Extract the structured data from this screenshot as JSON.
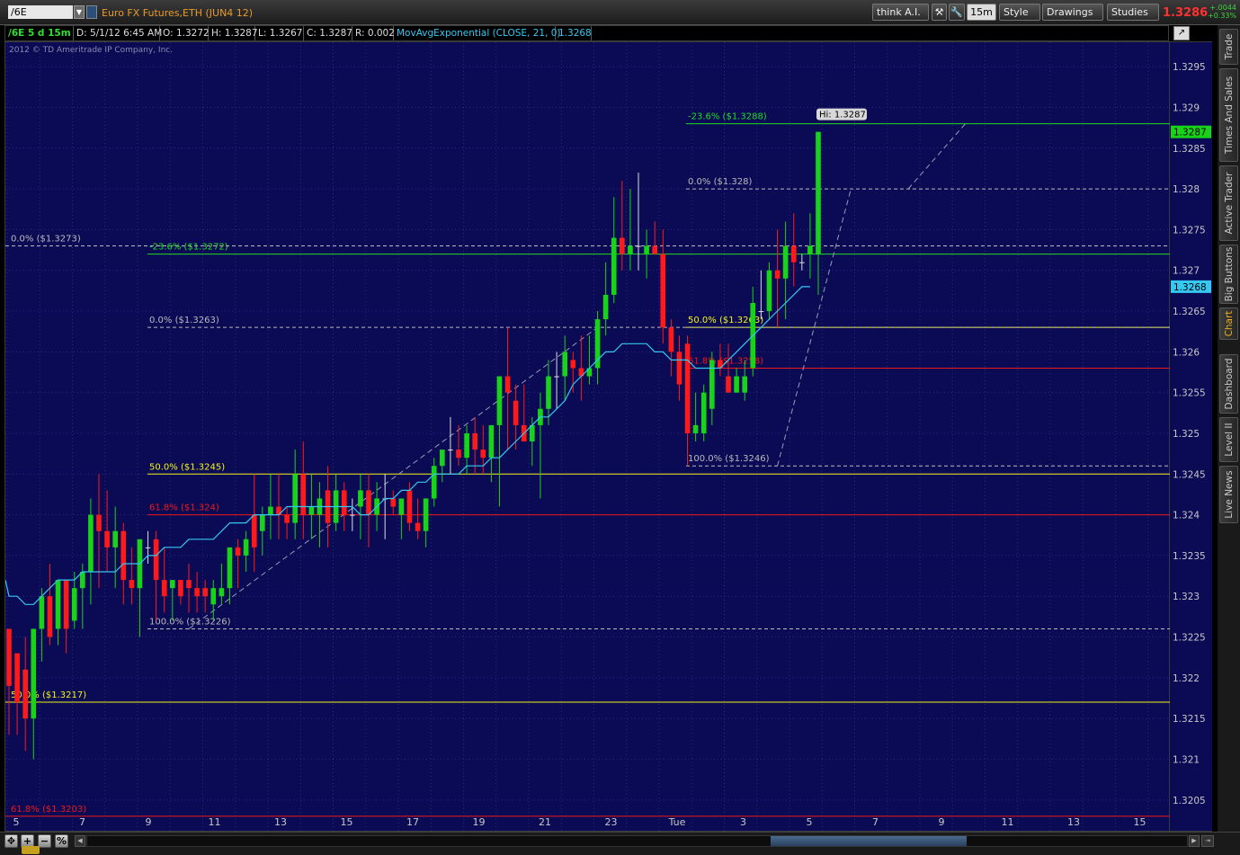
{
  "toolbar": {
    "symbol": "/6E",
    "description": "Euro FX Futures,ETH (JUN4 12)",
    "think_ai": "think A.I.",
    "period": "15m",
    "style": "Style",
    "drawings": "Drawings",
    "studies": "Studies",
    "last_price": "1.3286",
    "change_abs": "+.0044",
    "change_pct": "+0.33%"
  },
  "header": {
    "symbol_period": "/6E 5 d 15m",
    "date": "D: 5/1/12 6:45 AM",
    "open": "O: 1.3272",
    "high": "H: 1.3287",
    "low": "L: 1.3267",
    "close": "C: 1.3287",
    "range": "R: 0.002",
    "study": "MovAvgExponential (CLOSE, 21, 0)",
    "study_value": "1.3268"
  },
  "copyright": "2012 © TD Ameritrade IP Company, Inc.",
  "side_tabs": [
    "Trade",
    "Times And Sales",
    "Active Trader",
    "Big Buttons",
    "Chart",
    "Dashboard",
    "Level II",
    "Live News"
  ],
  "active_tab": "Chart",
  "colors": {
    "background": "#0b0a55",
    "up_candle": "#18d318",
    "down_candle": "#ff1a1a",
    "ema": "#35c8f0",
    "fib_50": "#f3f318",
    "fib_618": "#f01818",
    "fib_236": "#22dd22",
    "fib_0": "#bbbbbb"
  },
  "chart_data": {
    "type": "candlestick",
    "ylim": [
      1.3201,
      1.3298
    ],
    "y_ticks": [
      "1.3295",
      "1.329",
      "1.3285",
      "1.328",
      "1.3275",
      "1.327",
      "1.3265",
      "1.326",
      "1.3255",
      "1.325",
      "1.3245",
      "1.324",
      "1.3235",
      "1.323",
      "1.3225",
      "1.322",
      "1.3215",
      "1.321",
      "1.3205"
    ],
    "x_tick_labels": [
      "5",
      "7",
      "9",
      "11",
      "13",
      "15",
      "17",
      "19",
      "21",
      "23",
      "Tue",
      "3",
      "5",
      "7",
      "9",
      "11",
      "13",
      "15",
      "17"
    ],
    "candles": [
      {
        "o": 1.3226,
        "h": 1.3226,
        "l": 1.3213,
        "c": 1.3219
      },
      {
        "o": 1.3223,
        "h": 1.3223,
        "l": 1.3213,
        "c": 1.3217
      },
      {
        "o": 1.3221,
        "h": 1.3225,
        "l": 1.3211,
        "c": 1.3215
      },
      {
        "o": 1.3215,
        "h": 1.3226,
        "l": 1.321,
        "c": 1.3226
      },
      {
        "o": 1.3226,
        "h": 1.3231,
        "l": 1.3222,
        "c": 1.323
      },
      {
        "o": 1.323,
        "h": 1.3234,
        "l": 1.3224,
        "c": 1.3225
      },
      {
        "o": 1.3226,
        "h": 1.3232,
        "l": 1.3224,
        "c": 1.3232
      },
      {
        "o": 1.3232,
        "h": 1.3232,
        "l": 1.3223,
        "c": 1.3226
      },
      {
        "o": 1.3227,
        "h": 1.3233,
        "l": 1.3226,
        "c": 1.3231
      },
      {
        "o": 1.3231,
        "h": 1.3234,
        "l": 1.3226,
        "c": 1.3233
      },
      {
        "o": 1.3233,
        "h": 1.3242,
        "l": 1.3229,
        "c": 1.324
      },
      {
        "o": 1.324,
        "h": 1.3245,
        "l": 1.3231,
        "c": 1.3238
      },
      {
        "o": 1.3238,
        "h": 1.3243,
        "l": 1.3233,
        "c": 1.3236
      },
      {
        "o": 1.3236,
        "h": 1.3241,
        "l": 1.3231,
        "c": 1.3238
      },
      {
        "o": 1.3238,
        "h": 1.3239,
        "l": 1.3229,
        "c": 1.3232
      },
      {
        "o": 1.3232,
        "h": 1.3236,
        "l": 1.3229,
        "c": 1.3231
      },
      {
        "o": 1.3231,
        "h": 1.3235,
        "l": 1.3225,
        "c": 1.3237
      },
      {
        "o": 1.3236,
        "h": 1.3238,
        "l": 1.3234,
        "c": 1.3236
      },
      {
        "o": 1.3237,
        "h": 1.3238,
        "l": 1.3227,
        "c": 1.3232
      },
      {
        "o": 1.3232,
        "h": 1.3236,
        "l": 1.3228,
        "c": 1.323
      },
      {
        "o": 1.3231,
        "h": 1.3232,
        "l": 1.3227,
        "c": 1.3232
      },
      {
        "o": 1.3232,
        "h": 1.3232,
        "l": 1.3229,
        "c": 1.323
      },
      {
        "o": 1.3232,
        "h": 1.3234,
        "l": 1.3228,
        "c": 1.3231
      },
      {
        "o": 1.3231,
        "h": 1.3233,
        "l": 1.3228,
        "c": 1.323
      },
      {
        "o": 1.3231,
        "h": 1.3232,
        "l": 1.3228,
        "c": 1.323
      },
      {
        "o": 1.3229,
        "h": 1.3232,
        "l": 1.3227,
        "c": 1.3231
      },
      {
        "o": 1.323,
        "h": 1.3234,
        "l": 1.3229,
        "c": 1.3231
      },
      {
        "o": 1.3231,
        "h": 1.3235,
        "l": 1.3229,
        "c": 1.3236
      },
      {
        "o": 1.3236,
        "h": 1.3237,
        "l": 1.3231,
        "c": 1.3235
      },
      {
        "o": 1.3235,
        "h": 1.3238,
        "l": 1.3233,
        "c": 1.3237
      },
      {
        "o": 1.324,
        "h": 1.3245,
        "l": 1.3233,
        "c": 1.3236
      },
      {
        "o": 1.3238,
        "h": 1.3241,
        "l": 1.3235,
        "c": 1.324
      },
      {
        "o": 1.324,
        "h": 1.3245,
        "l": 1.3237,
        "c": 1.3241
      },
      {
        "o": 1.3241,
        "h": 1.3245,
        "l": 1.3237,
        "c": 1.324
      },
      {
        "o": 1.324,
        "h": 1.3241,
        "l": 1.3237,
        "c": 1.3239
      },
      {
        "o": 1.3239,
        "h": 1.3248,
        "l": 1.3237,
        "c": 1.3245
      },
      {
        "o": 1.3245,
        "h": 1.3249,
        "l": 1.3237,
        "c": 1.324
      },
      {
        "o": 1.324,
        "h": 1.3245,
        "l": 1.3237,
        "c": 1.3241
      },
      {
        "o": 1.324,
        "h": 1.3244,
        "l": 1.3236,
        "c": 1.3242
      },
      {
        "o": 1.3243,
        "h": 1.3246,
        "l": 1.3236,
        "c": 1.3239
      },
      {
        "o": 1.3239,
        "h": 1.3245,
        "l": 1.3238,
        "c": 1.3243
      },
      {
        "o": 1.3243,
        "h": 1.3244,
        "l": 1.3238,
        "c": 1.324
      },
      {
        "o": 1.324,
        "h": 1.3242,
        "l": 1.3238,
        "c": 1.324
      },
      {
        "o": 1.3241,
        "h": 1.3245,
        "l": 1.3237,
        "c": 1.3243
      },
      {
        "o": 1.3243,
        "h": 1.3245,
        "l": 1.3236,
        "c": 1.324
      },
      {
        "o": 1.324,
        "h": 1.3244,
        "l": 1.3238,
        "c": 1.3242
      },
      {
        "o": 1.3242,
        "h": 1.3245,
        "l": 1.3237,
        "c": 1.3242
      },
      {
        "o": 1.3242,
        "h": 1.3243,
        "l": 1.324,
        "c": 1.3241
      },
      {
        "o": 1.324,
        "h": 1.3242,
        "l": 1.3237,
        "c": 1.3242
      },
      {
        "o": 1.3243,
        "h": 1.3244,
        "l": 1.3238,
        "c": 1.3239
      },
      {
        "o": 1.3239,
        "h": 1.3242,
        "l": 1.3237,
        "c": 1.3238
      },
      {
        "o": 1.3238,
        "h": 1.3242,
        "l": 1.3236,
        "c": 1.3242
      },
      {
        "o": 1.3242,
        "h": 1.3247,
        "l": 1.3241,
        "c": 1.3246
      },
      {
        "o": 1.3246,
        "h": 1.3248,
        "l": 1.3244,
        "c": 1.3248
      },
      {
        "o": 1.3248,
        "h": 1.3252,
        "l": 1.3245,
        "c": 1.3248
      },
      {
        "o": 1.3248,
        "h": 1.3251,
        "l": 1.3246,
        "c": 1.3247
      },
      {
        "o": 1.3247,
        "h": 1.3251,
        "l": 1.3245,
        "c": 1.325
      },
      {
        "o": 1.325,
        "h": 1.3252,
        "l": 1.3245,
        "c": 1.3248
      },
      {
        "o": 1.3248,
        "h": 1.3251,
        "l": 1.3245,
        "c": 1.3247
      },
      {
        "o": 1.3247,
        "h": 1.325,
        "l": 1.3244,
        "c": 1.3251
      },
      {
        "o": 1.3251,
        "h": 1.3255,
        "l": 1.3241,
        "c": 1.3257
      },
      {
        "o": 1.3257,
        "h": 1.3263,
        "l": 1.3248,
        "c": 1.3255
      },
      {
        "o": 1.3254,
        "h": 1.3256,
        "l": 1.3248,
        "c": 1.3251
      },
      {
        "o": 1.3251,
        "h": 1.3256,
        "l": 1.3249,
        "c": 1.3249
      },
      {
        "o": 1.3249,
        "h": 1.3252,
        "l": 1.3246,
        "c": 1.3251
      },
      {
        "o": 1.3251,
        "h": 1.3255,
        "l": 1.3242,
        "c": 1.3253
      },
      {
        "o": 1.3253,
        "h": 1.3259,
        "l": 1.3251,
        "c": 1.3257
      },
      {
        "o": 1.3257,
        "h": 1.326,
        "l": 1.3253,
        "c": 1.3257
      },
      {
        "o": 1.3257,
        "h": 1.3262,
        "l": 1.3254,
        "c": 1.326
      },
      {
        "o": 1.3259,
        "h": 1.326,
        "l": 1.3255,
        "c": 1.3258
      },
      {
        "o": 1.3258,
        "h": 1.3262,
        "l": 1.3254,
        "c": 1.3257
      },
      {
        "o": 1.3257,
        "h": 1.3262,
        "l": 1.3256,
        "c": 1.3258
      },
      {
        "o": 1.3258,
        "h": 1.3265,
        "l": 1.3256,
        "c": 1.3264
      },
      {
        "o": 1.3264,
        "h": 1.3271,
        "l": 1.3262,
        "c": 1.3267
      },
      {
        "o": 1.3267,
        "h": 1.3279,
        "l": 1.3266,
        "c": 1.3274
      },
      {
        "o": 1.3274,
        "h": 1.3281,
        "l": 1.327,
        "c": 1.3272
      },
      {
        "o": 1.3272,
        "h": 1.328,
        "l": 1.327,
        "c": 1.3273
      },
      {
        "o": 1.3273,
        "h": 1.3282,
        "l": 1.327,
        "c": 1.3273
      },
      {
        "o": 1.3272,
        "h": 1.3275,
        "l": 1.3269,
        "c": 1.3273
      },
      {
        "o": 1.3273,
        "h": 1.3276,
        "l": 1.3272,
        "c": 1.3272
      },
      {
        "o": 1.3272,
        "h": 1.3275,
        "l": 1.3261,
        "c": 1.3263
      },
      {
        "o": 1.3263,
        "h": 1.3264,
        "l": 1.3257,
        "c": 1.326
      },
      {
        "o": 1.326,
        "h": 1.3262,
        "l": 1.3254,
        "c": 1.3256
      },
      {
        "o": 1.3261,
        "h": 1.3262,
        "l": 1.3246,
        "c": 1.325
      },
      {
        "o": 1.325,
        "h": 1.3255,
        "l": 1.3249,
        "c": 1.3251
      },
      {
        "o": 1.325,
        "h": 1.3256,
        "l": 1.3249,
        "c": 1.3255
      },
      {
        "o": 1.3253,
        "h": 1.326,
        "l": 1.3251,
        "c": 1.3259
      },
      {
        "o": 1.3259,
        "h": 1.3261,
        "l": 1.3257,
        "c": 1.3258
      },
      {
        "o": 1.3257,
        "h": 1.3261,
        "l": 1.3255,
        "c": 1.3255
      },
      {
        "o": 1.3255,
        "h": 1.3258,
        "l": 1.3255,
        "c": 1.3257
      },
      {
        "o": 1.3255,
        "h": 1.3259,
        "l": 1.3254,
        "c": 1.3257
      },
      {
        "o": 1.3258,
        "h": 1.3268,
        "l": 1.3257,
        "c": 1.3266
      },
      {
        "o": 1.3265,
        "h": 1.327,
        "l": 1.3264,
        "c": 1.3265
      },
      {
        "o": 1.3265,
        "h": 1.3271,
        "l": 1.3264,
        "c": 1.327
      },
      {
        "o": 1.327,
        "h": 1.3275,
        "l": 1.3263,
        "c": 1.3269
      },
      {
        "o": 1.3269,
        "h": 1.3276,
        "l": 1.3264,
        "c": 1.3273
      },
      {
        "o": 1.3273,
        "h": 1.3277,
        "l": 1.3268,
        "c": 1.3271
      },
      {
        "o": 1.3271,
        "h": 1.3272,
        "l": 1.327,
        "c": 1.3271
      },
      {
        "o": 1.3272,
        "h": 1.3277,
        "l": 1.3269,
        "c": 1.3273
      },
      {
        "o": 1.3272,
        "h": 1.3287,
        "l": 1.3267,
        "c": 1.3287
      }
    ],
    "ema": [
      1.323,
      1.323,
      1.3229,
      1.3229,
      1.323,
      1.3231,
      1.3232,
      1.3232,
      1.3232,
      1.3233,
      1.3233,
      1.3233,
      1.3233,
      1.3233,
      1.3234,
      1.3234,
      1.3234,
      1.3235,
      1.3235,
      1.3236,
      1.3236,
      1.3236,
      1.3237,
      1.3237,
      1.3237,
      1.3237,
      1.3238,
      1.3239,
      1.3239,
      1.3239,
      1.324,
      1.324,
      1.324,
      1.324,
      1.3241,
      1.3241,
      1.3241,
      1.3241,
      1.3241,
      1.3241,
      1.3241,
      1.3241,
      1.3241,
      1.324,
      1.324,
      1.3241,
      1.3242,
      1.3242,
      1.3243,
      1.3243,
      1.3244,
      1.3244,
      1.3245,
      1.3245,
      1.3245,
      1.3245,
      1.3246,
      1.3246,
      1.3246,
      1.3247,
      1.3247,
      1.3248,
      1.3249,
      1.325,
      1.3251,
      1.3252,
      1.3252,
      1.3253,
      1.3254,
      1.3256,
      1.3257,
      1.3258,
      1.3259,
      1.326,
      1.326,
      1.3261,
      1.3261,
      1.3261,
      1.3261,
      1.326,
      1.326,
      1.3259,
      1.3259,
      1.3259,
      1.3258,
      1.3258,
      1.3258,
      1.3258,
      1.3259,
      1.326,
      1.3261,
      1.3262,
      1.3263,
      1.3264,
      1.3265,
      1.3266,
      1.3267,
      1.3268,
      1.3268
    ],
    "fib_levels": [
      {
        "label": "-23.6%  ($1.3288)",
        "price": 1.3288,
        "kind": "fib_236"
      },
      {
        "label": "0.0%  ($1.328)",
        "price": 1.328,
        "kind": "fib_0"
      },
      {
        "label": "50.0%  ($1.3263)",
        "price": 1.3263,
        "kind": "fib_50"
      },
      {
        "label": "61.8%  ($1.3258)",
        "price": 1.3258,
        "kind": "fib_618"
      },
      {
        "label": "100.0%  ($1.3246)",
        "price": 1.3246,
        "kind": "fib_0"
      },
      {
        "label": "0.0%  ($1.3273)",
        "price": 1.3273,
        "kind": "fib_0"
      },
      {
        "label": "-23.6%  ($1.3272)",
        "price": 1.3272,
        "kind": "fib_236"
      },
      {
        "label": "0.0%  ($1.3263)",
        "price": 1.3263,
        "kind": "fib_0"
      },
      {
        "label": "50.0%  ($1.3245)",
        "price": 1.3245,
        "kind": "fib_50"
      },
      {
        "label": "61.8%  ($1.324)",
        "price": 1.324,
        "kind": "fib_618"
      },
      {
        "label": "100.0%  ($1.3226)",
        "price": 1.3226,
        "kind": "fib_0"
      },
      {
        "label": "50.0%  ($1.3217)",
        "price": 1.3217,
        "kind": "fib_50"
      },
      {
        "label": "61.8%  ($1.3203)",
        "price": 1.3203,
        "kind": "fib_618"
      }
    ],
    "high_bubble": "Hi: 1.3287",
    "price_tags": [
      {
        "label": "1.3287",
        "price": 1.3287,
        "kind": "up"
      },
      {
        "label": "1.3268",
        "price": 1.3268,
        "kind": "ema"
      }
    ]
  }
}
